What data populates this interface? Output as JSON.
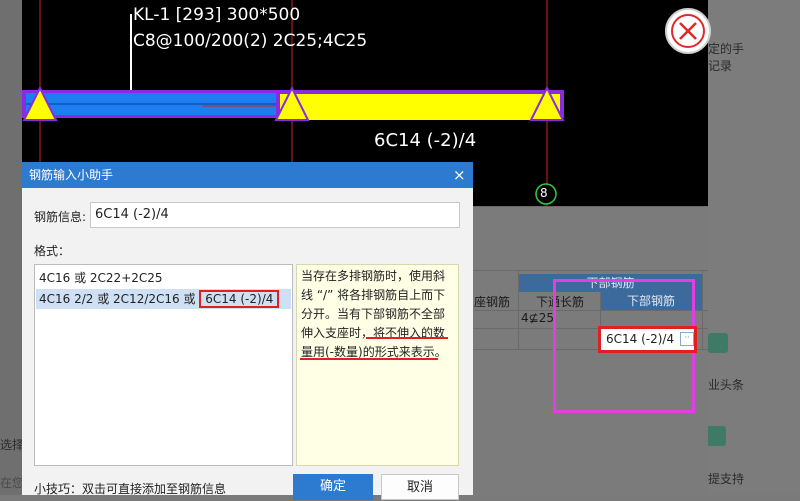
{
  "cad": {
    "beam_label_line1": "KL-1 [293] 300*500",
    "beam_label_line2": "C8@100/200(2) 2C25;4C25",
    "rebar_annotation": "6C14 (-2)/4",
    "axis_number": "8",
    "colors": {
      "beam_blue": "#1c7ef0",
      "beam_yellow": "#ffff00",
      "support_purple": "#8a2be2",
      "axis_red": "#d42020",
      "axis_green": "#2ecc40"
    }
  },
  "background_table": {
    "header_group": "下部钢筋",
    "col_seat_rebar": "座钢筋",
    "col_through_rebar": "下通长筋",
    "col_bottom_rebar": "下部钢筋",
    "cell_through_value": "4⊈25",
    "side_text_1": "定的手",
    "side_text_2": "记录",
    "side_text_3": "业头条",
    "side_text_4": "提支持",
    "left_text_1": "选择的",
    "left_text_2": "在您"
  },
  "dialog": {
    "title": "钢筋输入小助手",
    "close_glyph": "×",
    "rebar_info_label": "钢筋信息:",
    "rebar_info_value": "6C14 (-2)/4",
    "format_label": "格式：",
    "format_items": [
      {
        "text": "4C16 或 2C22+2C25",
        "highlight": ""
      },
      {
        "text": "4C16 2/2 或 2C12/2C16 或 ",
        "highlight": "6C14 (-2)/4"
      }
    ],
    "hint_lines": [
      "当存在多排钢筋时，使用斜",
      "线 “/” 将各排钢筋自上而下",
      "分开。当有下部钢筋不全部",
      "伸入支座时，将不伸入的数",
      "量用(-数量)的形式来表示。"
    ],
    "tip_text": "小技巧：双击可直接添加至钢筋信息",
    "ok_label": "确定",
    "cancel_label": "取消"
  },
  "overlay_cell": {
    "value": "6C14 (-2)/4",
    "ellipsis": "··"
  }
}
